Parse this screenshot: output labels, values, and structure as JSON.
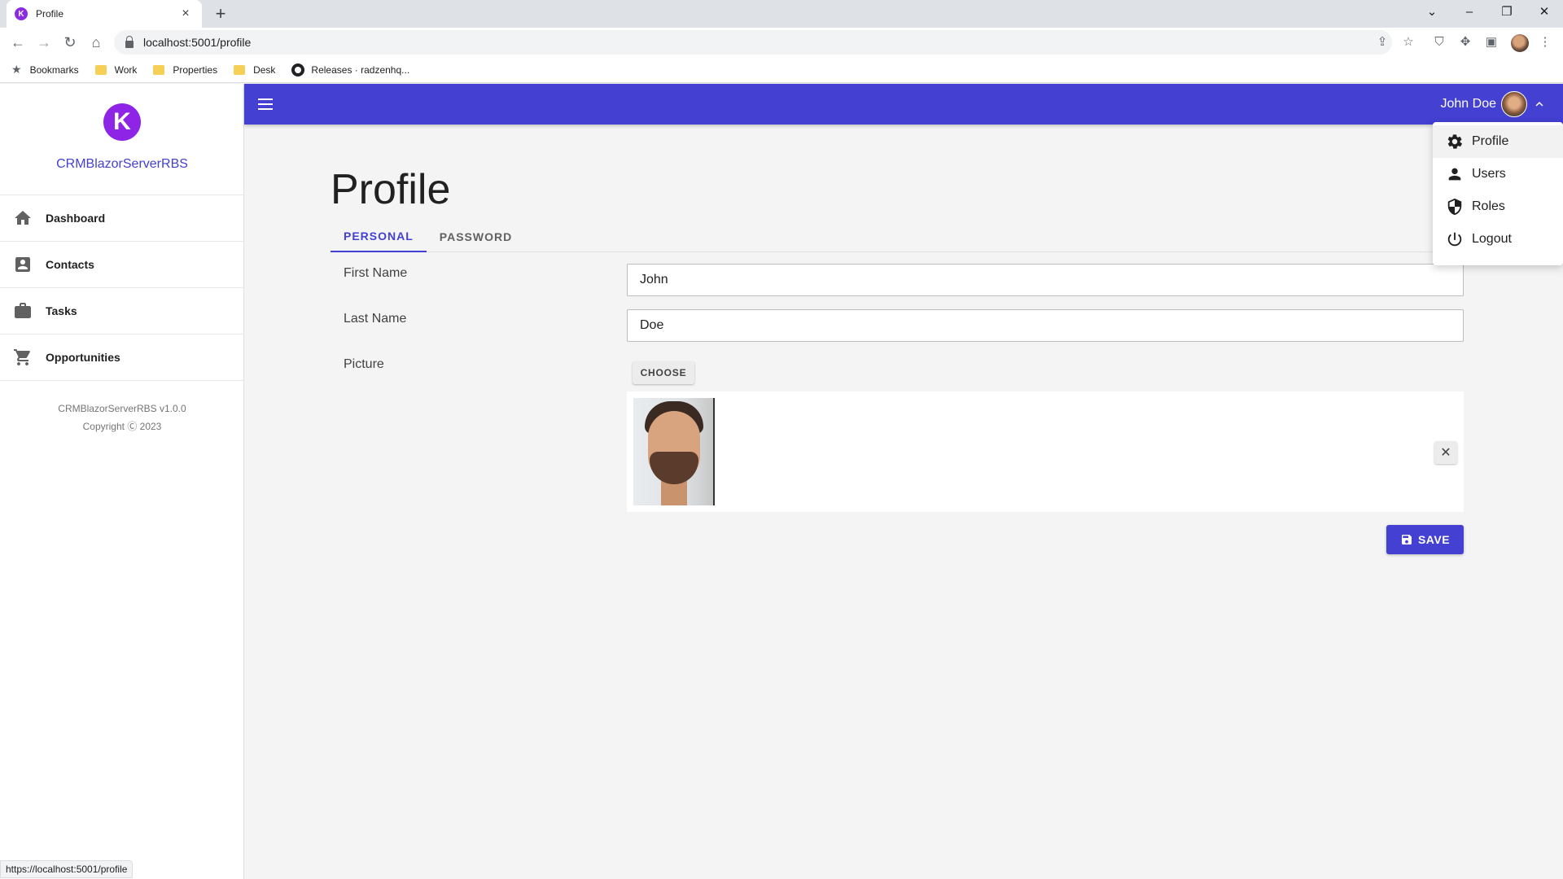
{
  "browser": {
    "tab_title": "Profile",
    "url": "localhost:5001/profile",
    "bookmarks": [
      "Bookmarks",
      "Work",
      "Properties",
      "Desk",
      "Releases · radzenhq..."
    ],
    "status_url": "https://localhost:5001/profile"
  },
  "sidebar": {
    "app_name": "CRMBlazorServerRBS",
    "items": [
      {
        "label": "Dashboard",
        "icon": "home-icon"
      },
      {
        "label": "Contacts",
        "icon": "contacts-icon"
      },
      {
        "label": "Tasks",
        "icon": "briefcase-icon"
      },
      {
        "label": "Opportunities",
        "icon": "cart-icon"
      }
    ],
    "version": "CRMBlazorServerRBS v1.0.0",
    "copyright": "Copyright Ⓒ 2023"
  },
  "topbar": {
    "user_name": "John Doe",
    "accent_color": "#4340d2"
  },
  "profile_menu": [
    {
      "label": "Profile",
      "icon": "gear-icon"
    },
    {
      "label": "Users",
      "icon": "person-icon"
    },
    {
      "label": "Roles",
      "icon": "shield-icon"
    },
    {
      "label": "Logout",
      "icon": "power-icon"
    }
  ],
  "page": {
    "title": "Profile",
    "tabs": [
      {
        "label": "PERSONAL",
        "active": true
      },
      {
        "label": "PASSWORD",
        "active": false
      }
    ],
    "first_name_label": "First Name",
    "first_name_value": "John",
    "last_name_label": "Last Name",
    "last_name_value": "Doe",
    "picture_label": "Picture",
    "choose_label": "CHOOSE",
    "remove_label": "✕",
    "save_label": "SAVE"
  }
}
